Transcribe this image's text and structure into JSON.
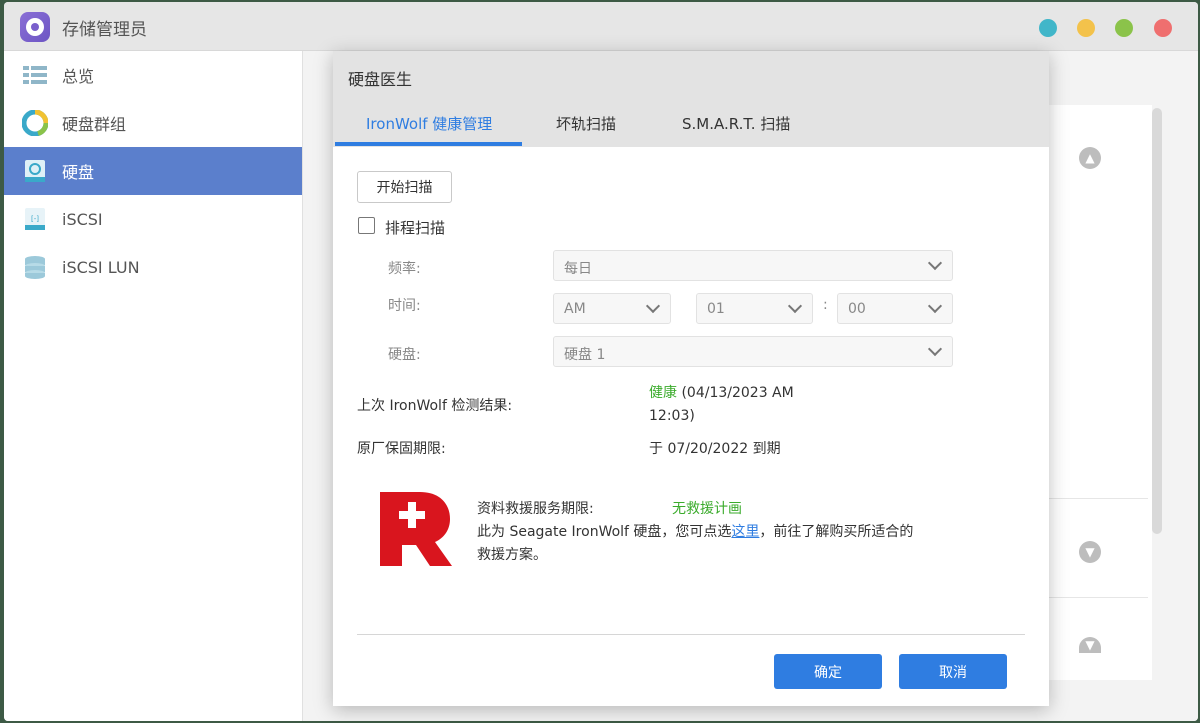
{
  "app": {
    "title": "存储管理员",
    "window_dots": [
      "#41b6c9",
      "#f3c24b",
      "#8bc34a",
      "#ef6f6f"
    ]
  },
  "sidebar": {
    "items": [
      {
        "label": "总览",
        "icon": "overview-icon"
      },
      {
        "label": "硬盘群组",
        "icon": "disk-group-icon"
      },
      {
        "label": "硬盘",
        "icon": "disk-icon",
        "active": true
      },
      {
        "label": "iSCSI",
        "icon": "iscsi-icon"
      },
      {
        "label": "iSCSI LUN",
        "icon": "iscsi-lun-icon"
      }
    ]
  },
  "dialog": {
    "title": "硬盘医生",
    "tabs": [
      {
        "label": "IronWolf 健康管理",
        "active": true
      },
      {
        "label": "坏轨扫描"
      },
      {
        "label": "S.M.A.R.T. 扫描"
      }
    ],
    "start_scan_label": "开始扫描",
    "schedule_label": "排程扫描",
    "schedule_checked": false,
    "frequency": {
      "label": "频率:",
      "value": "每日"
    },
    "time": {
      "label": "时间:",
      "period": "AM",
      "hour": "01",
      "separator": ":",
      "minute": "00"
    },
    "disk": {
      "label": "硬盘:",
      "value": "硬盘 1"
    },
    "last_result": {
      "label": "上次 IronWolf 检测结果:",
      "status": "健康",
      "detail_line1": "(04/13/2023 AM",
      "detail_line2": "12:03)"
    },
    "warranty": {
      "label": "原厂保固期限:",
      "value": "于 07/20/2022 到期"
    },
    "rescue": {
      "label": "资料救援服务期限:",
      "status": "无救援计画",
      "line2_prefix": "此为 Seagate IronWolf 硬盘，您可点选",
      "line2_link": "这里",
      "line2_suffix": "，前往了解购买所适合的",
      "line3": "救援方案。"
    },
    "ok_label": "确定",
    "cancel_label": "取消"
  },
  "colors": {
    "accent": "#2f7de1",
    "sidebar_active": "#5b7fcc",
    "healthy": "#3aab2b",
    "rescue_logo": "#d9151e"
  }
}
